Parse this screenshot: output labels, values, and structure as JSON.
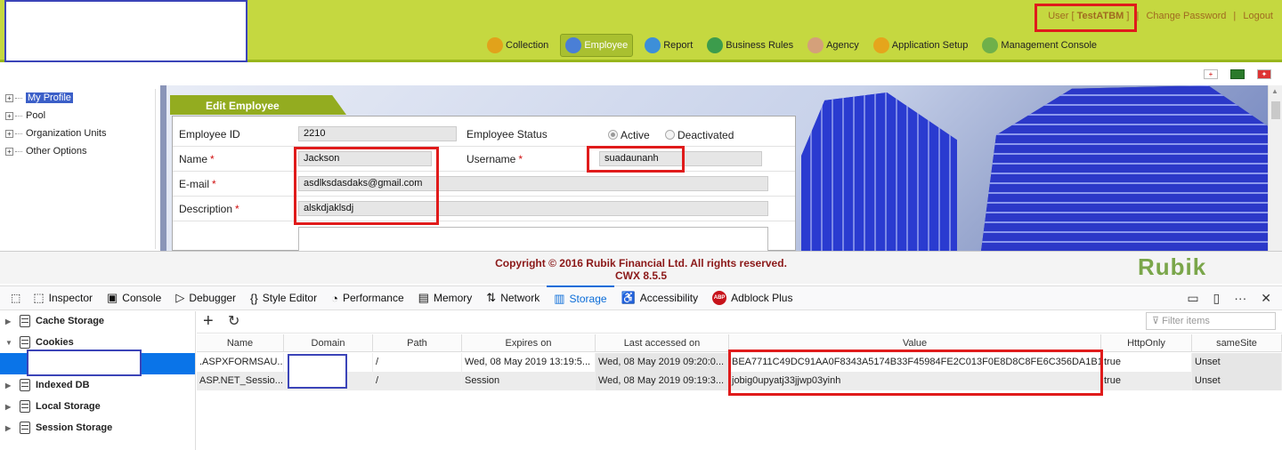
{
  "header": {
    "user_prefix": "User [",
    "user_name": "TestATBM",
    "user_suffix": "]",
    "change_password": "Change Password",
    "logout": "Logout",
    "nav": [
      {
        "label": "Collection",
        "icon": "collection-icon",
        "color": "#e1a21b"
      },
      {
        "label": "Employee",
        "icon": "employee-icon",
        "color": "#4a7fd6"
      },
      {
        "label": "Report",
        "icon": "report-icon",
        "color": "#3d8fd8"
      },
      {
        "label": "Business Rules",
        "icon": "business-rules-icon",
        "color": "#3c9c4c"
      },
      {
        "label": "Agency",
        "icon": "agency-icon",
        "color": "#d4a07a"
      },
      {
        "label": "Application Setup",
        "icon": "application-setup-icon",
        "color": "#e5a51c"
      },
      {
        "label": "Management Console",
        "icon": "management-console-icon",
        "color": "#6fb04a"
      }
    ],
    "active_nav": "Employee"
  },
  "tree": {
    "items": [
      {
        "label": "My Profile",
        "selected": true
      },
      {
        "label": "Pool"
      },
      {
        "label": "Organization Units"
      },
      {
        "label": "Other Options"
      }
    ]
  },
  "form": {
    "title": "Edit Employee",
    "employee_id_label": "Employee ID",
    "employee_id_value": "2210",
    "status_label": "Employee Status",
    "status_active": "Active",
    "status_deactivated": "Deactivated",
    "name_label": "Name",
    "name_value": "Jackson",
    "username_label": "Username",
    "username_value": "suadaunanh",
    "email_label": "E-mail",
    "email_value": "asdlksdasdaks@gmail.com",
    "description_label": "Description",
    "description_value": "alskdjaklsdj",
    "required_mark": "*"
  },
  "footer": {
    "copyright": "Copyright © 2016 Rubik Financial Ltd. All rights reserved.",
    "version": "CWX 8.5.5",
    "brand": "Rubik"
  },
  "devtools": {
    "tabs": [
      {
        "label": "Inspector",
        "icon": "inspector-icon",
        "glyph": "⬚"
      },
      {
        "label": "Console",
        "icon": "console-icon",
        "glyph": "▣"
      },
      {
        "label": "Debugger",
        "icon": "debugger-icon",
        "glyph": "▷"
      },
      {
        "label": "Style Editor",
        "icon": "style-editor-icon",
        "glyph": "{}"
      },
      {
        "label": "Performance",
        "icon": "performance-icon",
        "glyph": "◔"
      },
      {
        "label": "Memory",
        "icon": "memory-icon",
        "glyph": "▤"
      },
      {
        "label": "Network",
        "icon": "network-icon",
        "glyph": "⇅"
      },
      {
        "label": "Storage",
        "icon": "storage-icon",
        "glyph": "▥"
      },
      {
        "label": "Accessibility",
        "icon": "accessibility-icon",
        "glyph": "♿"
      }
    ],
    "active_tab": "Storage",
    "adblock_label": "Adblock Plus",
    "adblock_badge": "ABP"
  },
  "storage": {
    "sidebar": [
      "Cache Storage",
      "Cookies",
      "Indexed DB",
      "Local Storage",
      "Session Storage"
    ],
    "filter_placeholder": "Filter items",
    "columns": [
      "Name",
      "Domain",
      "Path",
      "Expires on",
      "Last accessed on",
      "Value",
      "HttpOnly",
      "sameSite"
    ],
    "rows": [
      {
        "name": ".ASPXFORMSAU...",
        "domain": "",
        "path": "/",
        "expires": "Wed, 08 May 2019 13:19:5...",
        "accessed": "Wed, 08 May 2019 09:20:0...",
        "value": "BEA7711C49DC91AA0F8343A5174B33F45984FE2C013F0E8D8C8FE6C356DA1B1...",
        "httponly": "true",
        "samesite": "Unset"
      },
      {
        "name": "ASP.NET_Sessio...",
        "domain": "",
        "path": "/",
        "expires": "Session",
        "accessed": "Wed, 08 May 2019 09:19:3...",
        "value": "jobig0upyatj33jjwp03yinh",
        "httponly": "true",
        "samesite": "Unset"
      }
    ]
  },
  "colors": {
    "header": "#c5d840",
    "highlight": "#e01b1b",
    "devtools_accent": "#0a6cd8"
  }
}
